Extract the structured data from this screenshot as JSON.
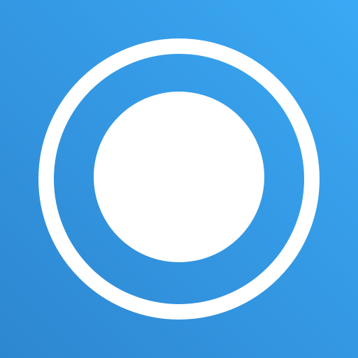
{
  "icon": {
    "name": "radio-button-icon",
    "colors": {
      "gradient_start": "#2e86d0",
      "gradient_end": "#3aa9f5",
      "mark": "#ffffff"
    }
  }
}
